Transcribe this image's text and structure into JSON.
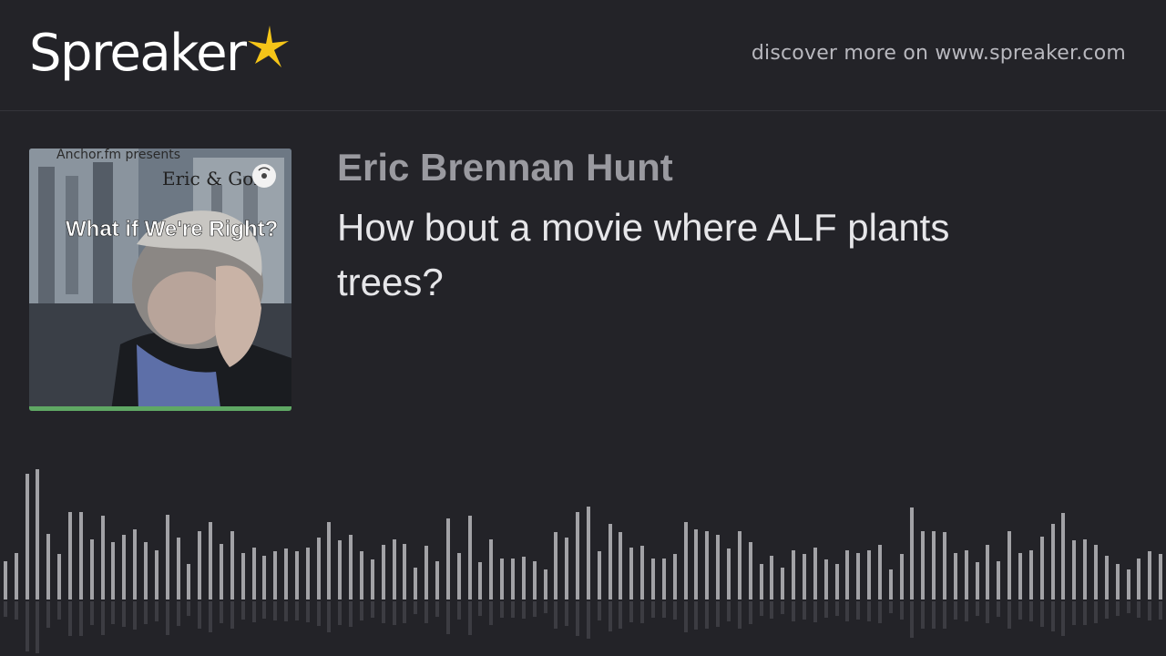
{
  "header": {
    "logo_text": "Spreaker",
    "logo_icon": "star-icon",
    "discover_text": "discover more on www.spreaker.com"
  },
  "episode": {
    "cover_art": {
      "text_top": "Anchor.fm presents",
      "text_names": "Eric & Gorc",
      "text_title": "What if We're Right?",
      "podcast_icon": "podcast-icon"
    },
    "author": "Eric Brennan Hunt",
    "title": "How bout a movie where ALF plants trees?"
  },
  "waveform": {
    "levels": [
      0.28,
      0.34,
      0.92,
      0.95,
      0.48,
      0.33,
      0.64,
      0.64,
      0.44,
      0.61,
      0.42,
      0.47,
      0.51,
      0.42,
      0.36,
      0.62,
      0.45,
      0.26,
      0.5,
      0.57,
      0.41,
      0.5,
      0.34,
      0.38,
      0.32,
      0.35,
      0.37,
      0.35,
      0.38,
      0.45,
      0.57,
      0.43,
      0.47,
      0.35,
      0.29,
      0.4,
      0.44,
      0.41,
      0.23,
      0.39,
      0.28,
      0.59,
      0.34,
      0.61,
      0.27,
      0.44,
      0.3,
      0.3,
      0.31,
      0.28,
      0.22,
      0.49,
      0.45,
      0.64,
      0.68,
      0.35,
      0.55,
      0.49,
      0.38,
      0.39,
      0.3,
      0.3,
      0.33,
      0.57,
      0.51,
      0.5,
      0.47,
      0.37,
      0.5,
      0.42,
      0.26,
      0.32,
      0.23,
      0.36,
      0.33,
      0.38,
      0.29,
      0.26,
      0.36,
      0.34,
      0.36,
      0.4,
      0.22,
      0.33,
      0.67,
      0.5,
      0.5,
      0.49,
      0.34,
      0.36,
      0.27,
      0.4,
      0.28,
      0.5,
      0.34,
      0.36,
      0.46,
      0.55,
      0.63,
      0.43,
      0.44,
      0.4,
      0.32,
      0.26,
      0.22,
      0.3,
      0.35,
      0.33
    ]
  },
  "colors": {
    "background": "#232328",
    "accent": "#f5c518",
    "progress": "#5fa864"
  }
}
